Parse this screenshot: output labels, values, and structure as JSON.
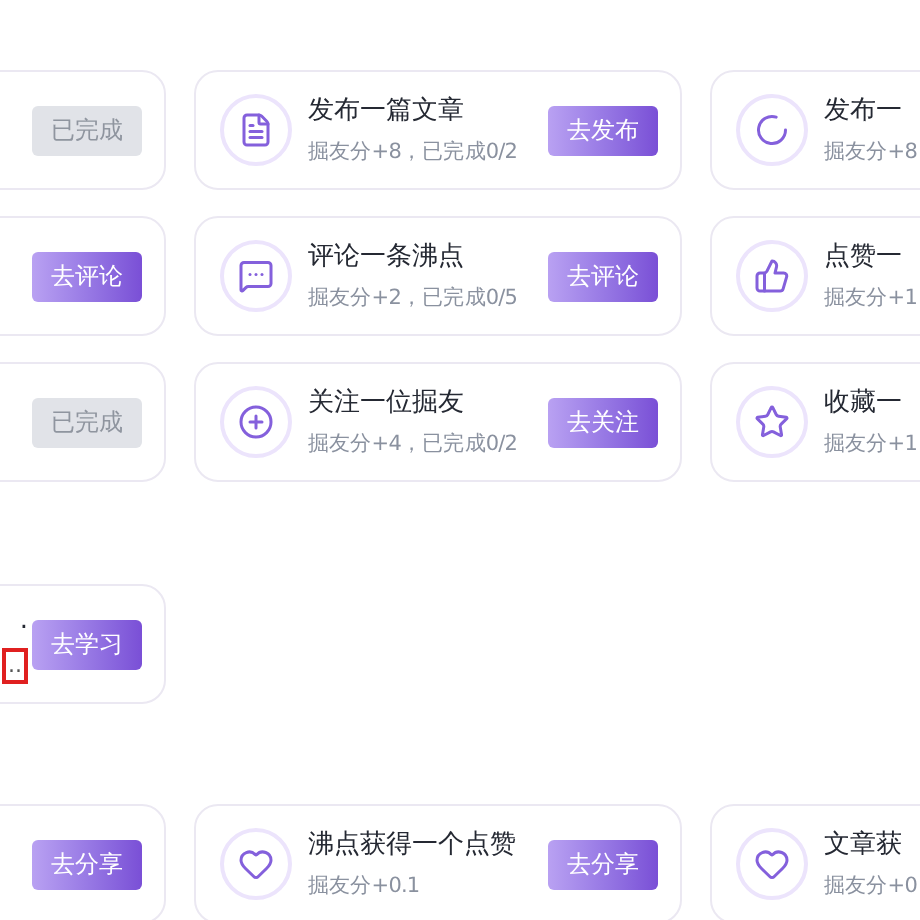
{
  "rows": [
    {
      "cards": [
        {
          "button": {
            "label": "已完成",
            "done": true
          }
        },
        {
          "title": "发布一篇文章",
          "desc": "掘友分+8，已完成0/2",
          "button": {
            "label": "去发布",
            "done": false
          }
        },
        {
          "title": "发布一",
          "desc": "掘友分+8"
        }
      ]
    },
    {
      "cards": [
        {
          "button": {
            "label": "去评论",
            "done": false
          }
        },
        {
          "title": "评论一条沸点",
          "desc": "掘友分+2，已完成0/5",
          "button": {
            "label": "去评论",
            "done": false
          }
        },
        {
          "title": "点赞一",
          "desc": "掘友分+1"
        }
      ]
    },
    {
      "cards": [
        {
          "button": {
            "label": "已完成",
            "done": true
          }
        },
        {
          "title": "关注一位掘友",
          "desc": "掘友分+4，已完成0/2",
          "button": {
            "label": "去关注",
            "done": false
          }
        },
        {
          "title": "收藏一",
          "desc": "掘友分+1"
        }
      ]
    },
    {
      "cards": [
        {
          "title": ".",
          "note": "..",
          "button": {
            "label": "去学习",
            "done": false
          }
        }
      ]
    },
    {
      "cards": [
        {
          "button": {
            "label": "去分享",
            "done": false
          }
        },
        {
          "title": "沸点获得一个点赞",
          "desc": "掘友分+0.1",
          "button": {
            "label": "去分享",
            "done": false
          }
        },
        {
          "title": "文章获",
          "desc": "掘友分+0"
        }
      ]
    }
  ]
}
